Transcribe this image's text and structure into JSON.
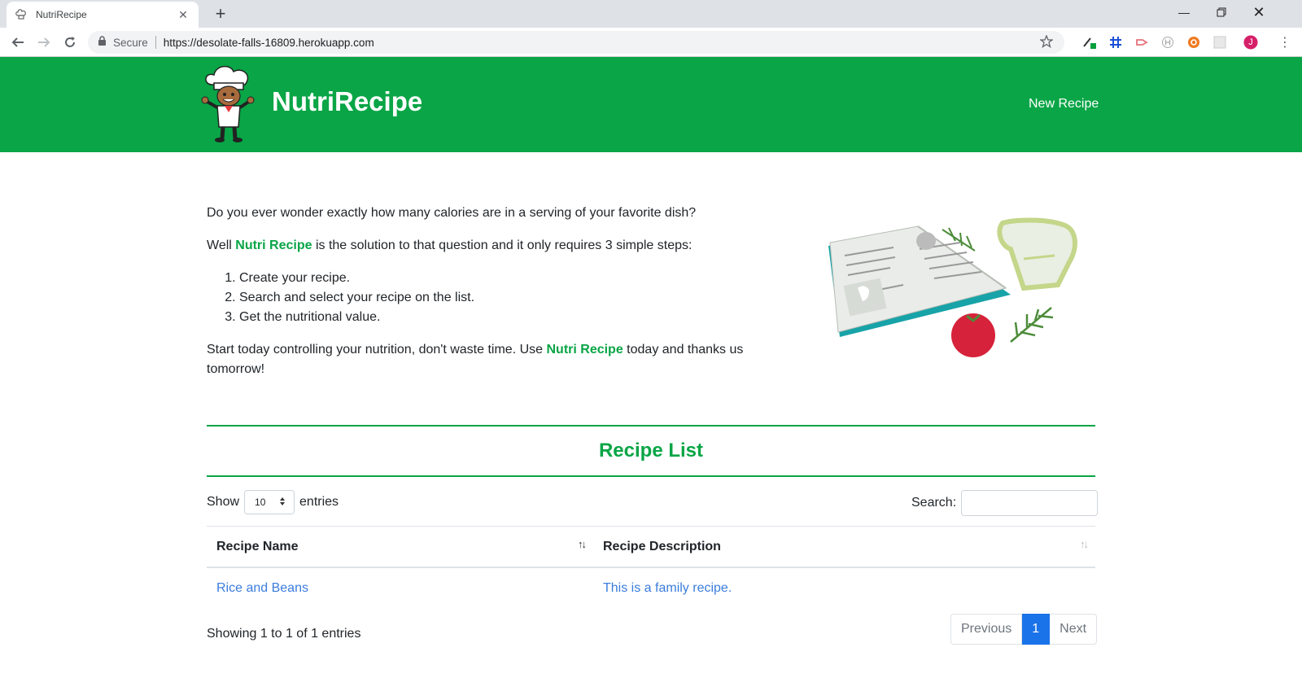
{
  "browser": {
    "tab_title": "NutriRecipe",
    "new_tab": "+",
    "secure_label": "Secure",
    "url": "https://desolate-falls-16809.herokuapp.com",
    "profile_initial": "J"
  },
  "header": {
    "brand": "NutriRecipe",
    "nav_new_recipe": "New Recipe"
  },
  "intro": {
    "question": "Do you ever wonder exactly how many calories are in a serving of your favorite dish?",
    "well_prefix": "Well ",
    "brand_inline": "Nutri Recipe",
    "well_suffix": " is the solution to that question and it only requires 3 simple steps:",
    "steps": [
      "Create your recipe.",
      "Search and select your recipe on the list.",
      "Get the nutritional value."
    ],
    "closing_prefix": "Start today controlling your nutrition, don't waste time. Use ",
    "closing_brand": "Nutri Recipe",
    "closing_suffix": " today and thanks us tomorrow!"
  },
  "recipe_list": {
    "title": "Recipe List",
    "show_label": "Show",
    "entries_value": "10",
    "entries_label": "entries",
    "search_label": "Search:",
    "search_value": "",
    "columns": [
      "Recipe Name",
      "Recipe Description"
    ],
    "rows": [
      {
        "name": "Rice and Beans",
        "description": "This is a family recipe."
      }
    ],
    "info": "Showing 1 to 1 of 1 entries",
    "pagination": {
      "previous": "Previous",
      "current": "1",
      "next": "Next"
    }
  },
  "colors": {
    "brand_green": "#09a546",
    "link_blue": "#3b7ddd",
    "active_page": "#1a73e8"
  }
}
